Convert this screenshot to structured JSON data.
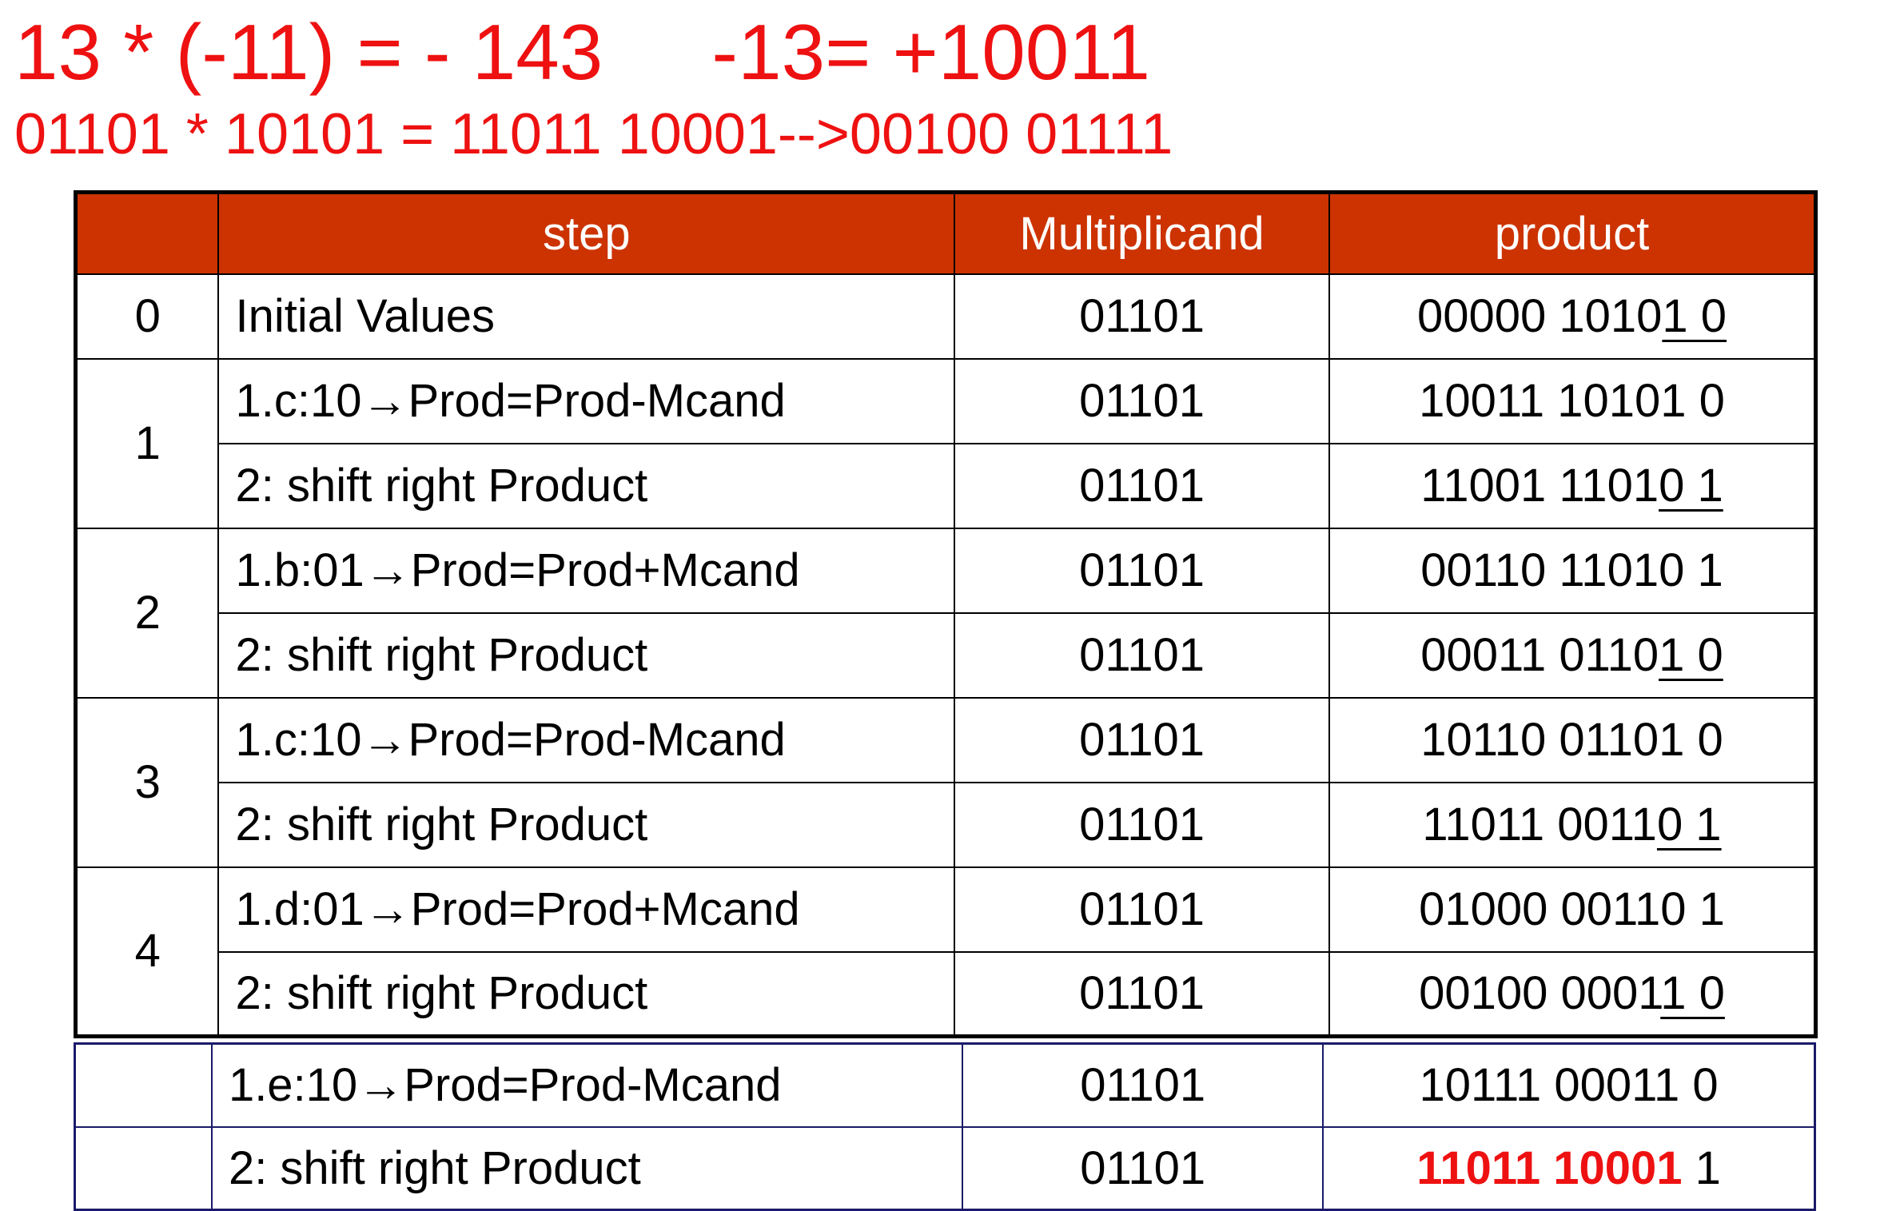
{
  "title": {
    "line1": "13 * (-11) = - 143     -13= +10011",
    "line2": "01101 * 10101 = 11011 10001-->00100 01111"
  },
  "table": {
    "headers": [
      "",
      "step",
      "Multiplicand",
      "product"
    ],
    "iterations": [
      {
        "num": "0",
        "rows": [
          {
            "step": "Initial Values",
            "mcand": "01101",
            "prod_a": "00000 1010",
            "prod_u": "1 0",
            "prod_b": ""
          }
        ]
      },
      {
        "num": "1",
        "rows": [
          {
            "step": "1.c:10→Prod=Prod-Mcand",
            "mcand": "01101",
            "prod_a": "10011 10101 0",
            "prod_u": "",
            "prod_b": ""
          },
          {
            "step": "2: shift right Product",
            "mcand": "01101",
            "prod_a": "11001 1101",
            "prod_u": "0 1",
            "prod_b": ""
          }
        ]
      },
      {
        "num": "2",
        "rows": [
          {
            "step": "1.b:01→Prod=Prod+Mcand",
            "mcand": "01101",
            "prod_a": "00110 11010 1",
            "prod_u": "",
            "prod_b": ""
          },
          {
            "step": "2: shift right Product",
            "mcand": "01101",
            "prod_a": "00011 0110",
            "prod_u": "1 0",
            "prod_b": ""
          }
        ]
      },
      {
        "num": "3",
        "rows": [
          {
            "step": "1.c:10→Prod=Prod-Mcand",
            "mcand": "01101",
            "prod_a": "10110 01101 0",
            "prod_u": "",
            "prod_b": ""
          },
          {
            "step": "2: shift right Product",
            "mcand": "01101",
            "prod_a": "11011 0011",
            "prod_u": "0 1",
            "prod_b": ""
          }
        ]
      },
      {
        "num": "4",
        "rows": [
          {
            "step": "1.d:01→Prod=Prod+Mcand",
            "mcand": "01101",
            "prod_a": "01000 00110 1",
            "prod_u": "",
            "prod_b": ""
          },
          {
            "step": "2: shift right Product",
            "mcand": "01101",
            "prod_a": "00100 0001",
            "prod_u": "1 0",
            "prod_b": ""
          }
        ]
      }
    ]
  },
  "extra": {
    "rows": [
      {
        "num": "",
        "step": "1.e:10→Prod=Prod-Mcand",
        "mcand": "01101",
        "prod_red": "",
        "prod_rest": "10111 00011 0"
      },
      {
        "num": "",
        "step": "2: shift right Product",
        "mcand": "01101",
        "prod_red": "11011 10001",
        "prod_rest": " 1"
      }
    ]
  }
}
